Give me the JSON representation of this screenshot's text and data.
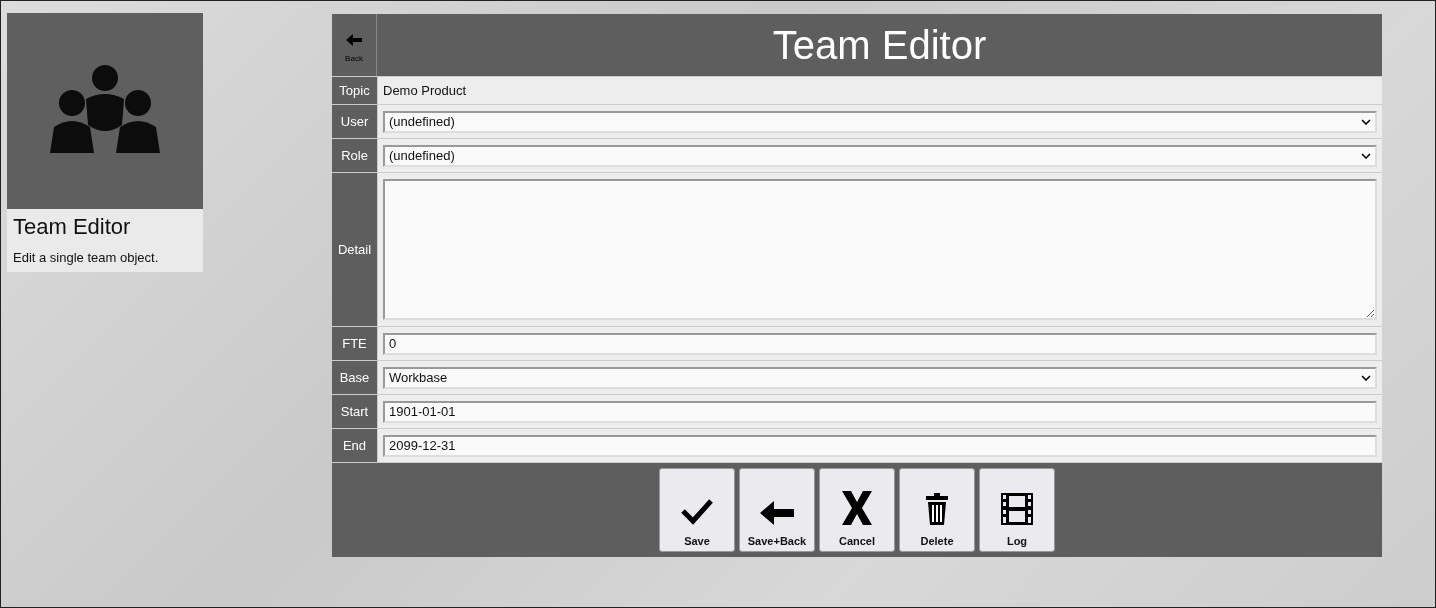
{
  "card": {
    "title": "Team Editor",
    "description": "Edit a single team object."
  },
  "header": {
    "back_label": "Back",
    "title": "Team Editor"
  },
  "fields": [
    {
      "label": "Topic",
      "kind": "text",
      "value": "Demo Product"
    },
    {
      "label": "User",
      "kind": "select",
      "value": "(undefined)"
    },
    {
      "label": "Role",
      "kind": "select",
      "value": "(undefined)"
    },
    {
      "label": "Detail",
      "kind": "textarea"
    },
    {
      "label": "FTE",
      "kind": "input",
      "value": "0"
    },
    {
      "label": "Base",
      "kind": "select",
      "value": "Workbase"
    },
    {
      "label": "Start",
      "kind": "input",
      "value": "1901-01-01"
    },
    {
      "label": "End",
      "kind": "input",
      "value": "2099-12-31"
    }
  ],
  "buttons": [
    {
      "label": "Save"
    },
    {
      "label": "Save+Back"
    },
    {
      "label": "Cancel"
    },
    {
      "label": "Delete"
    },
    {
      "label": "Log"
    }
  ]
}
